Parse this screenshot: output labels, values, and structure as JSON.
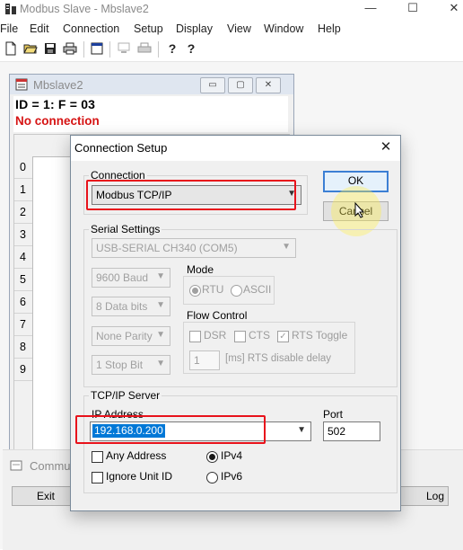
{
  "app": {
    "title": "Modbus Slave - Mbslave2",
    "window_controls": [
      "—",
      "☐",
      "✕"
    ]
  },
  "menu": [
    "File",
    "Edit",
    "Connection",
    "Setup",
    "Display",
    "View",
    "Window",
    "Help"
  ],
  "toolbar": {
    "icons": [
      "new-file-icon",
      "open-folder-icon",
      "save-icon",
      "print-icon",
      "window-icon",
      "disabled-monitor-icon",
      "disabled-printer-icon",
      "help-icon",
      "context-help-icon"
    ],
    "help_glyph": "?",
    "context_help_glyph": "?"
  },
  "child_window": {
    "title": "Mbslave2",
    "id_line": "ID = 1: F = 03",
    "status": "No connection",
    "rows": [
      "0",
      "1",
      "2",
      "3",
      "4",
      "5",
      "6",
      "7",
      "8",
      "9"
    ],
    "minimize_glyph": "▭",
    "maximize_glyph": "▢",
    "close_glyph": "✕"
  },
  "comm_window": {
    "title": "Commu",
    "exit_label": "Exit",
    "log_label": "Log"
  },
  "dialog": {
    "title": "Connection Setup",
    "close_glyph": "✕",
    "connection": {
      "label": "Connection",
      "value": "Modbus TCP/IP"
    },
    "ok_label": "OK",
    "cancel_label": "Cancel",
    "serial": {
      "label": "Serial Settings",
      "port": "USB-SERIAL CH340 (COM5)",
      "baud": "9600 Baud",
      "data_bits": "8 Data bits",
      "parity": "None Parity",
      "stop_bits": "1 Stop Bit",
      "mode_label": "Mode",
      "mode_rtu": "RTU",
      "mode_ascii": "ASCII",
      "mode_selected": "RTU",
      "flow_label": "Flow Control",
      "dsr": "DSR",
      "cts": "CTS",
      "rts_toggle": "RTS Toggle",
      "rts_toggle_checked": true,
      "rts_delay_value": "1",
      "rts_delay_label": "[ms] RTS disable delay"
    },
    "tcp": {
      "label": "TCP/IP Server",
      "ip_label": "IP Address",
      "ip_value": "192.168.0.200",
      "port_label": "Port",
      "port_value": "502",
      "any_address": "Any Address",
      "ignore_unit_id": "Ignore Unit ID",
      "ipv4": "IPv4",
      "ipv6": "IPv6",
      "ip_version_selected": "IPv4"
    }
  },
  "colors": {
    "highlight_red": "#e8121b",
    "status_red": "#d61414",
    "selection_blue": "#0078d7",
    "default_button_border": "#3c7fd4"
  }
}
